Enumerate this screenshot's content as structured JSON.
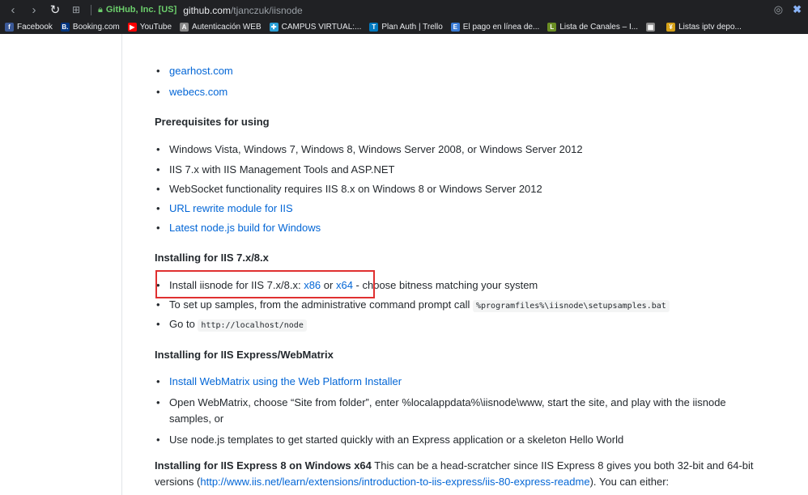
{
  "browser": {
    "url_org": "GitHub, Inc. [US]",
    "url_host": "github.com",
    "url_path": "/tjanczuk/iisnode"
  },
  "bookmarks": [
    {
      "label": "Facebook",
      "color": "#3b5998",
      "glyph": "f"
    },
    {
      "label": "Booking.com",
      "color": "#003580",
      "glyph": "B."
    },
    {
      "label": "YouTube",
      "color": "#ff0000",
      "glyph": "▶"
    },
    {
      "label": "Autenticación WEB",
      "color": "#888888",
      "glyph": "A"
    },
    {
      "label": "CAMPUS VIRTUAL:...",
      "color": "#2a9fd6",
      "glyph": "✚"
    },
    {
      "label": "Plan Auth | Trello",
      "color": "#0079bf",
      "glyph": "T"
    },
    {
      "label": "El pago en línea de...",
      "color": "#3a7bd5",
      "glyph": "E"
    },
    {
      "label": "Lista de Canales – I...",
      "color": "#6b8e23",
      "glyph": "L"
    },
    {
      "label": "",
      "color": "#8a8a8a",
      "glyph": "▦"
    },
    {
      "label": "Listas iptv depo...",
      "color": "#d4a017",
      "glyph": "¥"
    }
  ],
  "hosts": [
    "gearhost.com",
    "webecs.com"
  ],
  "prereq": {
    "heading": "Prerequisites for using",
    "items": [
      "Windows Vista, Windows 7, Windows 8, Windows Server 2008, or Windows Server 2012",
      "IIS 7.x with IIS Management Tools and ASP.NET",
      "WebSocket functionality requires IIS 8.x on Windows 8 or Windows Server 2012"
    ],
    "link1": "URL rewrite module for IIS",
    "link2": "Latest node.js build for Windows"
  },
  "install78": {
    "heading": "Installing for IIS 7.x/8.x",
    "item1_prefix": "Install iisnode for IIS 7.x/8.x: ",
    "item1_link_x86": "x86",
    "item1_or": " or ",
    "item1_link_x64": "x64",
    "item1_suffix": " - choose bitness matching your system",
    "item2_prefix": "To set up samples, from the administrative command prompt call ",
    "item2_code": "%programfiles%\\iisnode\\setupsamples.bat",
    "item3_prefix": "Go to ",
    "item3_code": "http://localhost/node"
  },
  "express": {
    "heading": "Installing for IIS Express/WebMatrix",
    "link1": "Install WebMatrix using the Web Platform Installer",
    "item2_line1": "Open WebMatrix, choose “Site from folder”, enter %localappdata%\\iisnode\\www, start the site, and play with the iisnode",
    "item2_line2": "samples, or",
    "item3": "Use node.js templates to get started quickly with an Express application or a skeleton Hello World"
  },
  "express8": {
    "bold": "Installing for IIS Express 8 on Windows x64",
    "text1": " This can be a head-scratcher since IIS Express 8 gives you both 32-bit and 64-bit versions (",
    "link": "http://www.iis.net/learn/extensions/introduction-to-iis-express/iis-80-express-readme",
    "text2": "). You can either:"
  }
}
